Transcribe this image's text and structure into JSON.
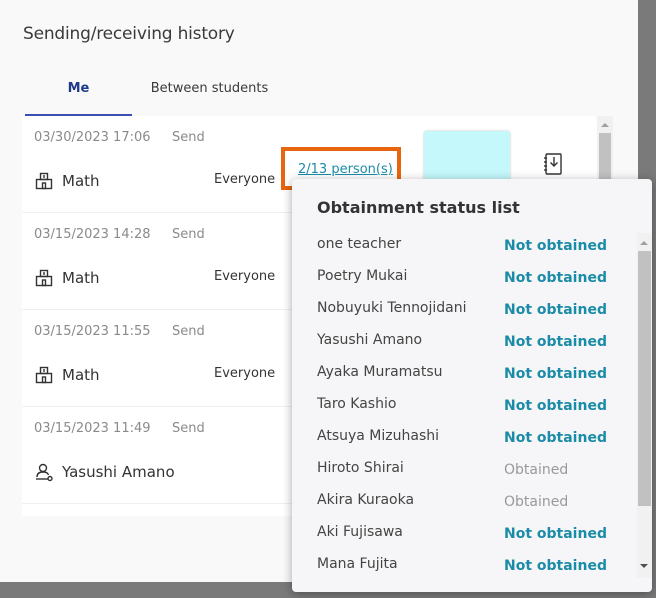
{
  "dialog": {
    "title": "Sending/receiving history",
    "tabs": [
      {
        "label": "Me",
        "active": true
      },
      {
        "label": "Between students",
        "active": false
      }
    ]
  },
  "history": [
    {
      "date": "03/30/2023 17:06",
      "kind": "Send",
      "icon": "class-icon",
      "subject": "Math",
      "target": "Everyone",
      "count_link": "2/13 person(s)",
      "thumbnail_color": "#c4f8fb",
      "has_download": true
    },
    {
      "date": "03/15/2023 14:28",
      "kind": "Send",
      "icon": "class-icon",
      "subject": "Math",
      "target": "Everyone"
    },
    {
      "date": "03/15/2023 11:55",
      "kind": "Send",
      "icon": "class-icon",
      "subject": "Math",
      "target": "Everyone"
    },
    {
      "date": "03/15/2023 11:49",
      "kind": "Send",
      "icon": "person-icon",
      "subject": "Yasushi Amano",
      "target": ""
    }
  ],
  "popover": {
    "title": "Obtainment status list",
    "entries": [
      {
        "name": "one teacher",
        "status": "Not obtained"
      },
      {
        "name": "Poetry Mukai",
        "status": "Not obtained"
      },
      {
        "name": "Nobuyuki Tennojidani",
        "status": "Not obtained"
      },
      {
        "name": "Yasushi Amano",
        "status": "Not obtained"
      },
      {
        "name": "Ayaka Muramatsu",
        "status": "Not obtained"
      },
      {
        "name": "Taro Kashio",
        "status": "Not obtained"
      },
      {
        "name": "Atsuya Mizuhashi",
        "status": "Not obtained"
      },
      {
        "name": "Hiroto Shirai",
        "status": "Obtained"
      },
      {
        "name": "Akira Kuraoka",
        "status": "Obtained"
      },
      {
        "name": "Aki Fujisawa",
        "status": "Not obtained"
      },
      {
        "name": "Mana Fujita",
        "status": "Not obtained"
      }
    ]
  },
  "colors": {
    "accent": "#1b8ca8",
    "tab_active": "#1f3a8a",
    "highlight": "#e8650f"
  }
}
